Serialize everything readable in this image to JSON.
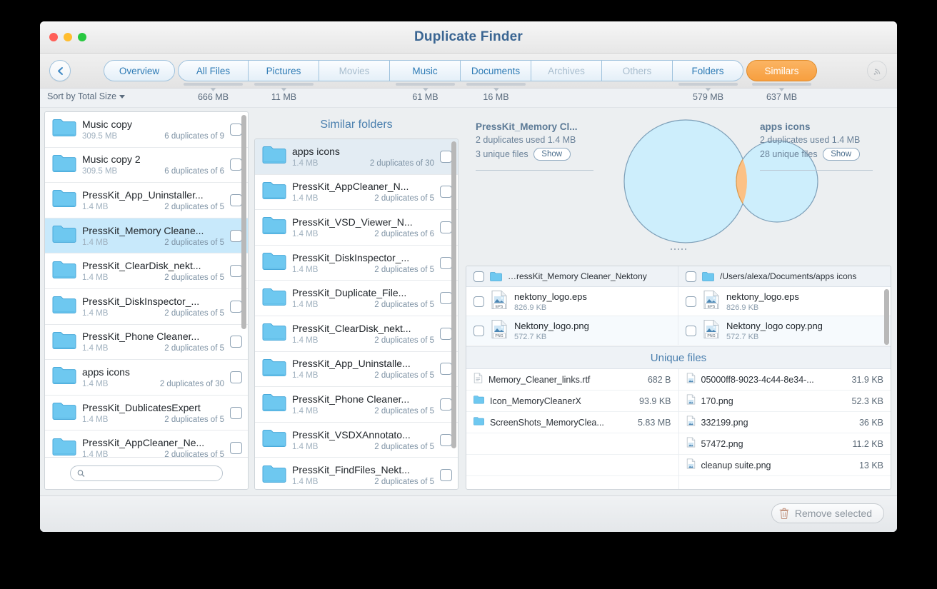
{
  "window": {
    "title": "Duplicate Finder",
    "traffic_lights": [
      "close",
      "minimize",
      "zoom"
    ]
  },
  "toolbar": {
    "back_label": "Back",
    "rss_icon": "signal-icon",
    "tabs": [
      {
        "label": "Overview",
        "state": "normal",
        "size": ""
      },
      {
        "label": "All Files",
        "state": "normal",
        "size": "666 MB"
      },
      {
        "label": "Pictures",
        "state": "normal",
        "size": "11 MB"
      },
      {
        "label": "Movies",
        "state": "dim",
        "size": ""
      },
      {
        "label": "Music",
        "state": "normal",
        "size": "61 MB"
      },
      {
        "label": "Documents",
        "state": "normal",
        "size": "16 MB"
      },
      {
        "label": "Archives",
        "state": "dim",
        "size": ""
      },
      {
        "label": "Others",
        "state": "dim",
        "size": ""
      },
      {
        "label": "Folders",
        "state": "normal",
        "size": "579 MB"
      },
      {
        "label": "Similars",
        "state": "active",
        "size": "637 MB"
      }
    ]
  },
  "sortbar": {
    "sort_label": "Sort by Total Size"
  },
  "sidebar": {
    "search_placeholder": "",
    "search_value": "",
    "items": [
      {
        "name": "Music copy",
        "size": "309.5 MB",
        "dups": "6 duplicates of 9",
        "selected": false
      },
      {
        "name": "Music copy 2",
        "size": "309.5 MB",
        "dups": "6 duplicates of 6",
        "selected": false
      },
      {
        "name": "PressKit_App_Uninstaller...",
        "size": "1.4 MB",
        "dups": "2 duplicates of 5",
        "selected": false
      },
      {
        "name": "PressKit_Memory Cleane...",
        "size": "1.4 MB",
        "dups": "2 duplicates of 5",
        "selected": true
      },
      {
        "name": "PressKit_ClearDisk_nekt...",
        "size": "1.4 MB",
        "dups": "2 duplicates of 5",
        "selected": false
      },
      {
        "name": "PressKit_DiskInspector_...",
        "size": "1.4 MB",
        "dups": "2 duplicates of 5",
        "selected": false
      },
      {
        "name": "PressKit_Phone Cleaner...",
        "size": "1.4 MB",
        "dups": "2 duplicates of 5",
        "selected": false
      },
      {
        "name": "apps icons",
        "size": "1.4 MB",
        "dups": "2 duplicates of 30",
        "selected": false
      },
      {
        "name": "PressKit_DublicatesExpert",
        "size": "1.4 MB",
        "dups": "2 duplicates of 5",
        "selected": false
      },
      {
        "name": "PressKit_AppCleaner_Ne...",
        "size": "1.4 MB",
        "dups": "2 duplicates of 5",
        "selected": false
      }
    ]
  },
  "similar": {
    "title": "Similar folders",
    "items": [
      {
        "name": "apps icons",
        "size": "1.4 MB",
        "dups": "2 duplicates of 30",
        "selected": true
      },
      {
        "name": "PressKit_AppCleaner_N...",
        "size": "1.4 MB",
        "dups": "2 duplicates of 5",
        "selected": false
      },
      {
        "name": "PressKit_VSD_Viewer_N...",
        "size": "1.4 MB",
        "dups": "2 duplicates of 6",
        "selected": false
      },
      {
        "name": "PressKit_DiskInspector_...",
        "size": "1.4 MB",
        "dups": "2 duplicates of 5",
        "selected": false
      },
      {
        "name": "PressKit_Duplicate_File...",
        "size": "1.4 MB",
        "dups": "2 duplicates of 5",
        "selected": false
      },
      {
        "name": "PressKit_ClearDisk_nekt...",
        "size": "1.4 MB",
        "dups": "2 duplicates of 5",
        "selected": false
      },
      {
        "name": "PressKit_App_Uninstalle...",
        "size": "1.4 MB",
        "dups": "2 duplicates of 5",
        "selected": false
      },
      {
        "name": "PressKit_Phone Cleaner...",
        "size": "1.4 MB",
        "dups": "2 duplicates of 5",
        "selected": false
      },
      {
        "name": "PressKit_VSDXAnnotato...",
        "size": "1.4 MB",
        "dups": "2 duplicates of 5",
        "selected": false
      },
      {
        "name": "PressKit_FindFiles_Nekt...",
        "size": "1.4 MB",
        "dups": "2 duplicates of 5",
        "selected": false
      }
    ]
  },
  "venn": {
    "left": {
      "name": "PressKit_Memory Cl...",
      "duplicates": "2 duplicates used 1.4 MB",
      "unique": "3 unique files",
      "show_label": "Show"
    },
    "right": {
      "name": "apps icons",
      "duplicates": "2 duplicates used 1.4 MB",
      "unique": "28 unique files",
      "show_label": "Show"
    },
    "colors": {
      "circle_fill": "#cdeefc",
      "circle_stroke": "#7d9fb8",
      "intersection_fill": "#fcc185",
      "intersection_stroke": "#e09a4a"
    }
  },
  "duplicates": {
    "left_path": "…ressKit_Memory Cleaner_Nektony",
    "right_path": "/Users/alexa/Documents/apps icons",
    "rows": [
      {
        "left": {
          "name": "nektony_logo.eps",
          "size": "826.9 KB",
          "type": "EPS"
        },
        "right": {
          "name": "nektony_logo.eps",
          "size": "826.9 KB",
          "type": "EPS"
        }
      },
      {
        "left": {
          "name": "Nektony_logo.png",
          "size": "572.7 KB",
          "type": "PNG"
        },
        "right": {
          "name": "Nektony_logo copy.png",
          "size": "572.7 KB",
          "type": "PNG"
        }
      }
    ]
  },
  "unique_files": {
    "title": "Unique files",
    "left": [
      {
        "name": "Memory_Cleaner_links.rtf",
        "size": "682 B",
        "icon": "doc-icon"
      },
      {
        "name": "Icon_MemoryCleanerX",
        "size": "93.9 KB",
        "icon": "folder-icon"
      },
      {
        "name": "ScreenShots_MemoryClea...",
        "size": "5.83 MB",
        "icon": "folder-icon"
      }
    ],
    "right": [
      {
        "name": "05000ff8-9023-4c44-8e34-...",
        "size": "31.9 KB",
        "icon": "image-icon"
      },
      {
        "name": "170.png",
        "size": "52.3 KB",
        "icon": "image-icon"
      },
      {
        "name": "332199.png",
        "size": "36 KB",
        "icon": "image-icon"
      },
      {
        "name": "57472.png",
        "size": "11.2 KB",
        "icon": "image-icon"
      },
      {
        "name": "cleanup suite.png",
        "size": "13 KB",
        "icon": "image-icon"
      }
    ]
  },
  "footer": {
    "remove_label": "Remove selected",
    "trash_icon": "trash-icon"
  }
}
